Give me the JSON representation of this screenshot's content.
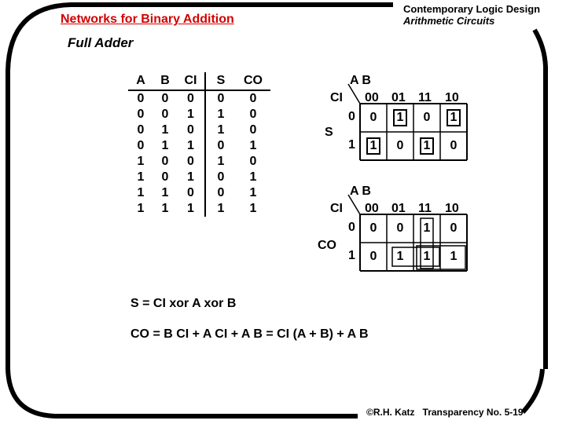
{
  "header": {
    "title": "Networks for Binary Addition",
    "subtitle": "Full Adder",
    "course_title": "Contemporary Logic Design",
    "course_topic": "Arithmetic Circuits"
  },
  "truth_table": {
    "columns": [
      "A",
      "B",
      "CI",
      "S",
      "CO"
    ],
    "rows": [
      [
        "0",
        "0",
        "0",
        "0",
        "0"
      ],
      [
        "0",
        "0",
        "1",
        "1",
        "0"
      ],
      [
        "0",
        "1",
        "0",
        "1",
        "0"
      ],
      [
        "0",
        "1",
        "1",
        "0",
        "1"
      ],
      [
        "1",
        "0",
        "0",
        "1",
        "0"
      ],
      [
        "1",
        "0",
        "1",
        "0",
        "1"
      ],
      [
        "1",
        "1",
        "0",
        "0",
        "1"
      ],
      [
        "1",
        "1",
        "1",
        "1",
        "1"
      ]
    ]
  },
  "kmaps": [
    {
      "output_label": "S",
      "col_var": "A B",
      "row_var": "CI",
      "col_headers": [
        "00",
        "01",
        "11",
        "10"
      ],
      "row_headers": [
        "0",
        "1"
      ],
      "cells": [
        [
          "0",
          "1",
          "0",
          "1"
        ],
        [
          "1",
          "0",
          "1",
          "0"
        ]
      ],
      "boxed_cells": [
        [
          0,
          1
        ],
        [
          0,
          3
        ],
        [
          1,
          0
        ],
        [
          1,
          2
        ]
      ]
    },
    {
      "output_label": "CO",
      "col_var": "A B",
      "row_var": "CI",
      "col_headers": [
        "00",
        "01",
        "11",
        "10"
      ],
      "row_headers": [
        "0",
        "1"
      ],
      "cells": [
        [
          "0",
          "0",
          "1",
          "0"
        ],
        [
          "0",
          "1",
          "1",
          "1"
        ]
      ]
    }
  ],
  "equations": {
    "sum": "S = CI xor A xor B",
    "carry": "CO = B CI  +  A CI  +  A B = CI (A + B) + A B"
  },
  "footer": {
    "copyright": "©R.H. Katz",
    "transparency": "Transparency No. 5-19"
  }
}
